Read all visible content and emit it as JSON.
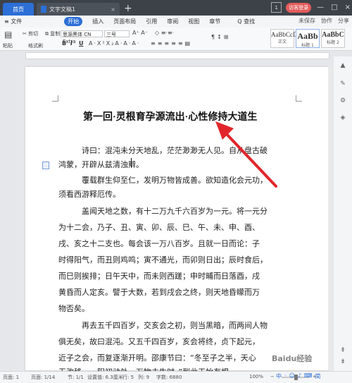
{
  "titlebar": {
    "home_tab": "首页",
    "doc_tab": "文字文稿1",
    "doc_tab_close": "×",
    "plus": "+",
    "badge": "1",
    "visitor": "访客登录",
    "min": "—",
    "max": "□",
    "close": "×"
  },
  "menubar": {
    "file": "≡ 文件",
    "items": [
      "开始",
      "插入",
      "页面布局",
      "引用",
      "审阅",
      "视图",
      "章节"
    ],
    "search": "Q 查找",
    "unsaved": "未保存",
    "collab": "协作",
    "share": "分享"
  },
  "ribbon": {
    "paste": "粘贴",
    "cut": "剪切",
    "copy": "复制",
    "format_painter": "格式刷",
    "font_name": "思源黑体 CN Extra",
    "font_size": "三号",
    "bold": "B",
    "italic": "I",
    "underline": "U",
    "style_body_preview": "AaBbCcDd",
    "style_body": "正文",
    "style_h1_preview": "AaBb",
    "style_h1": "标题 1",
    "style_h2_preview": "AaBbC",
    "style_h2": "标题 2"
  },
  "document": {
    "title": "第一回·灵根育孕源流出·心性修持大道生",
    "lines": [
      "诗曰：混沌未分天地乱，茫茫渺渺无人见。自从盘古破",
      "鸿蒙，开辟从兹清浊辨。",
      "覆载群生仰至仁，发明万物皆成善。欲知造化会元功，",
      "须看西游释厄传。",
      "盖闻天地之数，有十二万九千六百岁为一元。将一元分",
      "为十二会，乃子、丑、寅、卯、辰、巳、午、未、申、酉、",
      "戌、亥之十二支也。每会该一万八百岁。且就一日而论：子",
      "时得阳气，而丑则鸡鸣；寅不通光，而卯则日出；辰时食后，",
      "而巳则挨排；日午天中，而未则西蹉；申时晡而日落酉，戌",
      "黄昏而人定亥。譬于大数，若到戌会之终，则天地昏矇而万",
      "物否矣。",
      "再去五千四百岁，交亥会之初，则当黑暗，而两间人物",
      "俱无矣，故曰混沌。又五千四百岁，亥会将终，贞下起元，",
      "近子之会，而复逐渐开明。邵康节曰：“冬至子之半，天心",
      "无改移。一阳初动处，万物未生时。”到此天始有根。"
    ]
  },
  "statusbar": {
    "page": "页面: 1",
    "pages": "页面: 1/14",
    "section": "节: 1/1",
    "setting": "设置值: 6.3厘米",
    "row": "行: 5",
    "col": "列: 9",
    "words": "字数: 6880",
    "zoom": "100%",
    "zoom_minus": "−",
    "zoom_plus": "+",
    "zoom_level": 0.5
  },
  "watermark": "Baidu经验",
  "ime": [
    "中",
    "·",
    "☺",
    "♪",
    "⌨",
    "简"
  ]
}
